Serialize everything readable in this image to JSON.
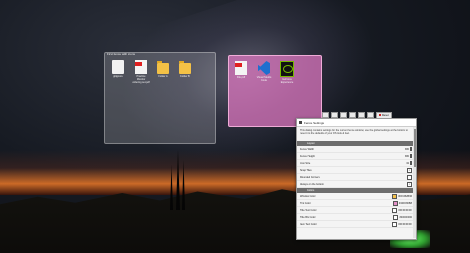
{
  "desktop": {
    "fence_a": {
      "title": "First fence with icons",
      "icons": [
        {
          "label": "gitignore",
          "kind": "doc"
        },
        {
          "label": "Practice Monitor ordering set.pdf",
          "kind": "pdf"
        },
        {
          "label": "Folder A",
          "kind": "folder"
        },
        {
          "label": "Folder B",
          "kind": "folder"
        }
      ]
    },
    "fence_b": {
      "title": "",
      "icons": [
        {
          "label": "File.pdf",
          "kind": "pdf"
        },
        {
          "label": "Visual Studio Code",
          "kind": "vs"
        },
        {
          "label": "GeForce Experience",
          "kind": "nv"
        }
      ]
    }
  },
  "settings": {
    "title": "Fence Settings",
    "reset_label": "Reset",
    "description": "This dialog contains settings for the current fence window; use the global settings at the bottom to reset it to the defaults of your OS look & feel.",
    "section_layout": "Layout",
    "section_colors": "Colors",
    "layout_rows": [
      {
        "label": "Fence Width",
        "value": "380",
        "control": "spin"
      },
      {
        "label": "Fence Height",
        "value": "380",
        "control": "spin"
      },
      {
        "label": "Icon Size",
        "value": "32",
        "control": "spin"
      },
      {
        "label": "Snap Tiles",
        "value": "✓",
        "control": "check"
      },
      {
        "label": "Rounded Corners",
        "value": "",
        "control": "check"
      },
      {
        "label": "Always on the bottom",
        "value": "✓",
        "control": "check"
      }
    ],
    "color_rows": [
      {
        "label": "Window Color",
        "value": "#FFCB2B96",
        "color": "#f3c14b"
      },
      {
        "label": "Tint Color",
        "value": "#40FF80B8",
        "color": "#e28fc6"
      },
      {
        "label": "Title Text Color",
        "value": "#FFFFFFFF",
        "color": "#ffffff"
      },
      {
        "label": "Title BG Color",
        "value": "#40000000",
        "color": "#ffffff"
      },
      {
        "label": "Item Text Color",
        "value": "#FFFFFFFF",
        "color": "#ffffff"
      }
    ]
  }
}
